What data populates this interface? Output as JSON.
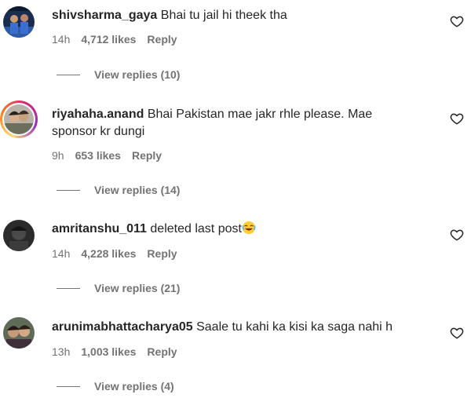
{
  "comments": [
    {
      "username": "shivsharma_gaya",
      "text": "Bhai tu jail hi theek tha",
      "time": "14h",
      "likes": "4,712 likes",
      "reply_label": "Reply",
      "replies_label": "View replies (10)"
    },
    {
      "username": "riyahaha.anand",
      "text": "Bhai Pakistan mae jakr rhle please. Mae sponsor kr dungi",
      "time": "9h",
      "likes": "653 likes",
      "reply_label": "Reply",
      "replies_label": "View replies (14)"
    },
    {
      "username": "amritanshu_011",
      "text": "deleted last post",
      "emoji": "laughing-emoji",
      "time": "14h",
      "likes": "4,228 likes",
      "reply_label": "Reply",
      "replies_label": "View replies (21)"
    },
    {
      "username": "arunimabhattacharya05",
      "text": "Saale tu kahi ka kisi ka saga nahi h",
      "time": "13h",
      "likes": "1,003 likes",
      "reply_label": "Reply",
      "replies_label": "View replies (4)"
    }
  ],
  "icons": {
    "like": "heart-outline-icon"
  },
  "colors": {
    "text": "#262626",
    "meta": "#737373",
    "story_ring_start": "#feda75",
    "story_ring_end": "#962fbf"
  }
}
